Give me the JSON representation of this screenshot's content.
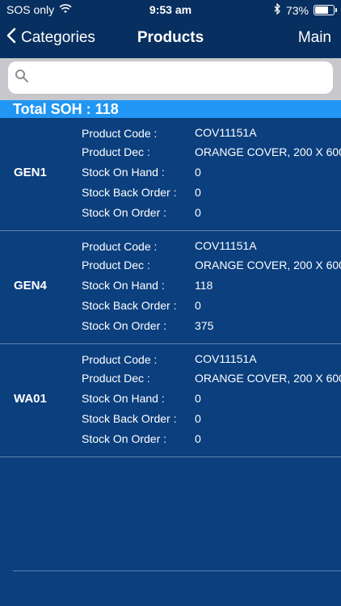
{
  "status_bar": {
    "carrier": "SOS only",
    "time": "9:53 am",
    "battery": "73%",
    "battery_level": 0.73
  },
  "nav": {
    "back_label": "Categories",
    "title": "Products",
    "right_label": "Main"
  },
  "search": {
    "placeholder": ""
  },
  "total_label": "Total SOH : 118",
  "labels": {
    "product_code": "Product Code :",
    "product_dec": "Product Dec :",
    "stock_on_hand": "Stock On Hand :",
    "stock_back_order": "Stock Back Order :",
    "stock_on_order": "Stock On Order :"
  },
  "rows": [
    {
      "location": "GEN1",
      "product_code": "COV11151A",
      "product_dec": "ORANGE COVER, 200 X 600",
      "stock_on_hand": "0",
      "stock_back_order": "0",
      "stock_on_order": "0"
    },
    {
      "location": "GEN4",
      "product_code": "COV11151A",
      "product_dec": "ORANGE COVER, 200 X 600",
      "stock_on_hand": "118",
      "stock_back_order": "0",
      "stock_on_order": "375"
    },
    {
      "location": "WA01",
      "product_code": "COV11151A",
      "product_dec": "ORANGE COVER, 200 X 600",
      "stock_on_hand": "0",
      "stock_back_order": "0",
      "stock_on_order": "0"
    }
  ]
}
